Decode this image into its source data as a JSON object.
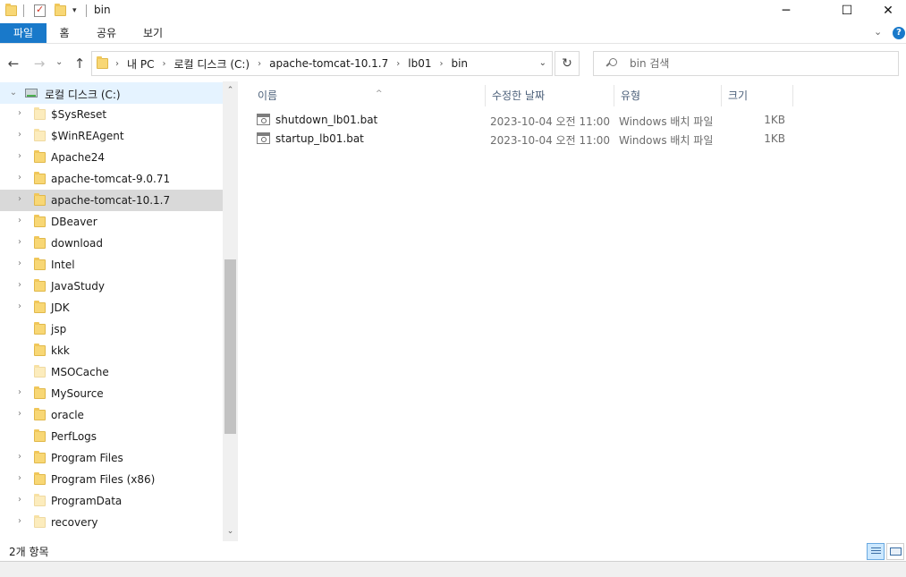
{
  "window": {
    "title": "bin",
    "minimize_glyph": "─",
    "maximize_glyph": "☐",
    "close_glyph": "✕"
  },
  "ribbon": {
    "tabs": [
      "파일",
      "홈",
      "공유",
      "보기"
    ],
    "active_tab": "파일",
    "accent_color": "#1979ca",
    "help_glyph": "?"
  },
  "address": {
    "crumbs": [
      "내 PC",
      "로컬 디스크 (C:)",
      "apache-tomcat-10.1.7",
      "lb01",
      "bin"
    ]
  },
  "search": {
    "placeholder": "bin 검색"
  },
  "nav_tree": {
    "root": {
      "label": "로컬 디스크 (C:)",
      "icon": "drive-icon"
    },
    "items": [
      {
        "label": "$SysReset",
        "expandable": true,
        "pale": true,
        "selected": false
      },
      {
        "label": "$WinREAgent",
        "expandable": true,
        "pale": true,
        "selected": false
      },
      {
        "label": "Apache24",
        "expandable": true,
        "pale": false,
        "selected": false
      },
      {
        "label": "apache-tomcat-9.0.71",
        "expandable": true,
        "pale": false,
        "selected": false
      },
      {
        "label": "apache-tomcat-10.1.7",
        "expandable": true,
        "pale": false,
        "selected": true
      },
      {
        "label": "DBeaver",
        "expandable": true,
        "pale": false,
        "selected": false
      },
      {
        "label": "download",
        "expandable": true,
        "pale": false,
        "selected": false
      },
      {
        "label": "Intel",
        "expandable": true,
        "pale": false,
        "selected": false
      },
      {
        "label": "JavaStudy",
        "expandable": true,
        "pale": false,
        "selected": false
      },
      {
        "label": "JDK",
        "expandable": true,
        "pale": false,
        "selected": false
      },
      {
        "label": "jsp",
        "expandable": false,
        "pale": false,
        "selected": false
      },
      {
        "label": "kkk",
        "expandable": false,
        "pale": false,
        "selected": false
      },
      {
        "label": "MSOCache",
        "expandable": false,
        "pale": true,
        "selected": false
      },
      {
        "label": "MySource",
        "expandable": true,
        "pale": false,
        "selected": false
      },
      {
        "label": "oracle",
        "expandable": true,
        "pale": false,
        "selected": false
      },
      {
        "label": "PerfLogs",
        "expandable": false,
        "pale": false,
        "selected": false
      },
      {
        "label": "Program Files",
        "expandable": true,
        "pale": false,
        "selected": false
      },
      {
        "label": "Program Files (x86)",
        "expandable": true,
        "pale": false,
        "selected": false
      },
      {
        "label": "ProgramData",
        "expandable": true,
        "pale": true,
        "selected": false
      },
      {
        "label": "recovery",
        "expandable": true,
        "pale": true,
        "selected": false
      }
    ]
  },
  "columns": [
    "이름",
    "수정한 날짜",
    "유형",
    "크기"
  ],
  "files": [
    {
      "name": "shutdown_lb01.bat",
      "date": "2023-10-04 오전 11:00",
      "type": "Windows 배치 파일",
      "size": "1KB"
    },
    {
      "name": "startup_lb01.bat",
      "date": "2023-10-04 오전 11:00",
      "type": "Windows 배치 파일",
      "size": "1KB"
    }
  ],
  "status": {
    "item_count": "2개 항목"
  }
}
